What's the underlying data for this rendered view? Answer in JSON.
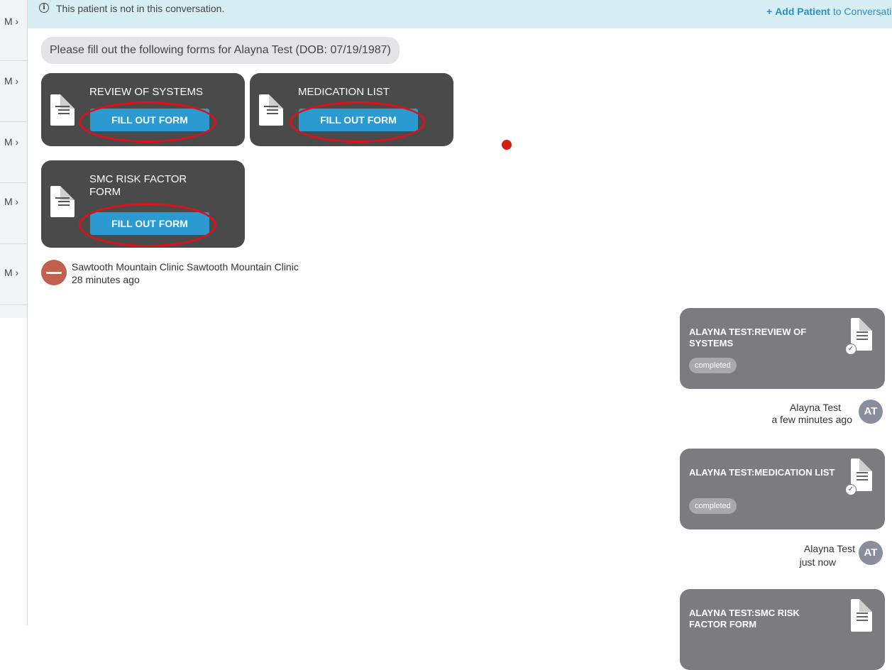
{
  "left_list": {
    "items": [
      {
        "label": "M ›"
      },
      {
        "label": "M ›"
      },
      {
        "label": "M ›"
      },
      {
        "label": "M ›"
      },
      {
        "label": "M ›"
      }
    ]
  },
  "notice": {
    "icon": "info-icon",
    "text": "This patient is not in this conversation.",
    "add_patient_prefix": "+",
    "add_patient_bold": "Add Patient",
    "add_patient_rest": " to Conversatio"
  },
  "prompt": {
    "text": "Please fill out the following forms for Alayna Test (DOB: 07/19/1987)"
  },
  "forms": [
    {
      "title": "REVIEW OF SYSTEMS",
      "button": "FILL OUT FORM",
      "icon": "document-icon"
    },
    {
      "title": "MEDICATION LIST",
      "button": "FILL OUT FORM",
      "icon": "document-icon"
    },
    {
      "title": "SMC RISK FACTOR FORM",
      "button": "FILL OUT FORM",
      "icon": "document-icon"
    }
  ],
  "clinic_message": {
    "sender": "Sawtooth Mountain Clinic Sawtooth Mountain Clinic",
    "time": "28 minutes ago"
  },
  "completed": [
    {
      "title": "ALAYNA TEST:REVIEW OF SYSTEMS",
      "status": "completed",
      "sender": "Alayna Test",
      "time": "a few minutes ago",
      "initials": "AT"
    },
    {
      "title": "ALAYNA TEST:MEDICATION LIST",
      "status": "completed",
      "sender": "Alayna Test",
      "time": "just now",
      "initials": "AT"
    },
    {
      "title": "ALAYNA TEST:SMC RISK FACTOR FORM",
      "status": "",
      "sender": "",
      "time": "",
      "initials": ""
    }
  ],
  "colors": {
    "notice_bg": "#d6eef4",
    "link": "#2a8fbf",
    "form_card": "#4a4a4a",
    "button": "#2a9ad0",
    "annotation": "#e0101a",
    "completed_card": "#7c7b7f",
    "clinic_avatar": "#c0604f"
  }
}
